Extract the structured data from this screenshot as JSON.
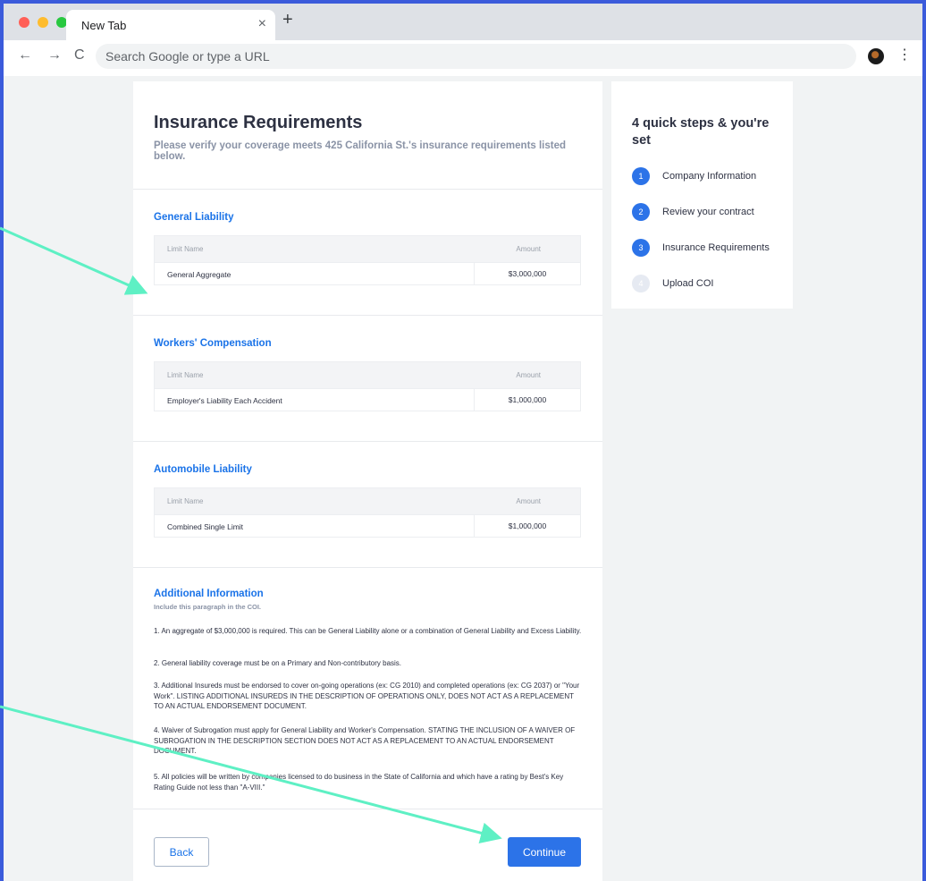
{
  "colors": {
    "frame": "#3b5bdb",
    "accent": "#1a73e8",
    "button": "#2c73e8",
    "arrow": "#5ef0c4",
    "dot_red": "#ff5f57",
    "dot_yellow": "#febc2e",
    "dot_green": "#28c840",
    "step_active": "#2c73e8",
    "step_inactive": "#e6eaf2"
  },
  "browser": {
    "tab_title": "New Tab",
    "close_glyph": "×",
    "new_tab_glyph": "+",
    "back_glyph": "←",
    "forward_glyph": "→",
    "reload_glyph": "C",
    "menu_glyph": "⋮",
    "omnibox_placeholder": "Search Google or type a URL"
  },
  "page": {
    "title": "Insurance Requirements",
    "subtitle": "Please verify your coverage meets 425 California St.'s insurance requirements listed below.",
    "sections": [
      {
        "title": "General Liability",
        "header_name": "Limit Name",
        "header_amount": "Amount",
        "row_name": "General Aggregate",
        "row_amount": "$3,000,000"
      },
      {
        "title": "Workers' Compensation",
        "header_name": "Limit Name",
        "header_amount": "Amount",
        "row_name": "Employer's Liability Each Accident",
        "row_amount": "$1,000,000"
      },
      {
        "title": "Automobile Liability",
        "header_name": "Limit Name",
        "header_amount": "Amount",
        "row_name": "Combined Single Limit",
        "row_amount": "$1,000,000"
      }
    ],
    "additional": {
      "title": "Additional Information",
      "subtitle": "Include this paragraph in the COI.",
      "paragraphs": [
        "1. An aggregate of $3,000,000 is required. This can be General Liability alone or a combination of General Liability and Excess Liability.",
        "2. General liability coverage must be on a Primary and Non-contributory basis.",
        "3. Additional Insureds must be endorsed to cover on-going operations (ex: CG 2010) and completed operations (ex: CG 2037) or \"Your Work\". LISTING ADDITIONAL INSUREDS IN THE DESCRIPTION OF OPERATIONS ONLY, DOES NOT ACT AS A REPLACEMENT TO AN ACTUAL ENDORSEMENT DOCUMENT.",
        "4. Waiver of Subrogation must apply for General Liability and Worker's Compensation. STATING THE INCLUSION OF A WAIVER OF SUBROGATION IN THE DESCRIPTION SECTION DOES NOT ACT AS A REPLACEMENT TO AN ACTUAL ENDORSEMENT DOCUMENT.",
        "5. All policies will be written by companies licensed to do business in the State of California and which have a rating by Best's Key Rating Guide not less than \"A-VIII.\""
      ]
    },
    "back_label": "Back",
    "continue_label": "Continue"
  },
  "steps": {
    "title": "4 quick steps & you're set",
    "items": [
      {
        "num": "1",
        "label": "Company Information",
        "active": true
      },
      {
        "num": "2",
        "label": "Review your contract",
        "active": true
      },
      {
        "num": "3",
        "label": "Insurance Requirements",
        "active": true
      },
      {
        "num": "4",
        "label": "Upload COI",
        "active": false
      }
    ]
  }
}
